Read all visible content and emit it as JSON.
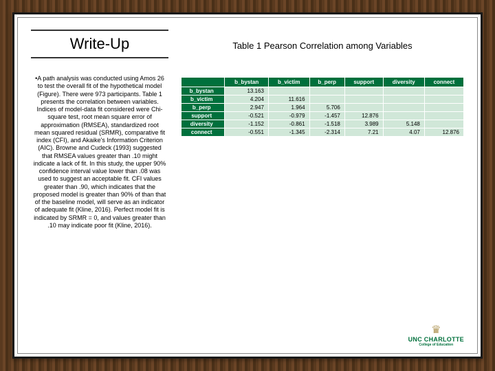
{
  "left": {
    "heading": "Write-Up",
    "body": "•A path analysis was conducted using Amos 26 to test the overall fit of the hypothetical model (Figure). There were 973 participants. Table 1 presents the correlation between variables. Indices of model-data fit considered were Chi-square test, root mean square error of approximation (RMSEA), standardized root mean squared residual (SRMR), comparative fit index (CFI), and Akaike's Information Criterion (AIC). Browne and Cudeck (1993) suggested that RMSEA values greater than .10 might indicate a lack of fit. In this study, the upper 90% confidence interval value lower than .08 was used to suggest an acceptable fit. CFI values greater than .90, which indicates that the proposed model is greater than 90% of than that of the baseline model, will serve as an indicator of adequate fit (Kline, 2016). Perfect model fit is indicated by SRMR = 0, and values greater than .10 may indicate poor fit (Kline, 2016)."
  },
  "right": {
    "table_title": "Table 1 Pearson Correlation among Variables",
    "headers": [
      "",
      "b_bystan",
      "b_victim",
      "b_perp",
      "support",
      "diversity",
      "connect"
    ],
    "rows": [
      {
        "label": "b_bystan",
        "cells": [
          "13.163",
          "",
          "",
          "",
          "",
          ""
        ]
      },
      {
        "label": "b_victim",
        "cells": [
          "4.204",
          "11.616",
          "",
          "",
          "",
          ""
        ]
      },
      {
        "label": "b_perp",
        "cells": [
          "2.947",
          "1.964",
          "5.706",
          "",
          "",
          ""
        ]
      },
      {
        "label": "support",
        "cells": [
          "-0.521",
          "-0.979",
          "-1.457",
          "12.876",
          "",
          ""
        ]
      },
      {
        "label": "diversity",
        "cells": [
          "-1.152",
          "-0.861",
          "-1.518",
          "3.989",
          "5.148",
          ""
        ]
      },
      {
        "label": "connect",
        "cells": [
          "-0.551",
          "-1.345",
          "-2.314",
          "7.21",
          "4.07",
          "12.876"
        ]
      }
    ]
  },
  "logo": {
    "name": "UNC CHARLOTTE",
    "sub": "College of Education"
  },
  "chart_data": {
    "type": "table",
    "title": "Table 1 Pearson Correlation among Variables",
    "columns": [
      "b_bystan",
      "b_victim",
      "b_perp",
      "support",
      "diversity",
      "connect"
    ],
    "rows": [
      "b_bystan",
      "b_victim",
      "b_perp",
      "support",
      "diversity",
      "connect"
    ],
    "matrix": [
      [
        13.163,
        null,
        null,
        null,
        null,
        null
      ],
      [
        4.204,
        11.616,
        null,
        null,
        null,
        null
      ],
      [
        2.947,
        1.964,
        5.706,
        null,
        null,
        null
      ],
      [
        -0.521,
        -0.979,
        -1.457,
        12.876,
        null,
        null
      ],
      [
        -1.152,
        -0.861,
        -1.518,
        3.989,
        5.148,
        null
      ],
      [
        -0.551,
        -1.345,
        -2.314,
        7.21,
        4.07,
        12.876
      ]
    ]
  }
}
